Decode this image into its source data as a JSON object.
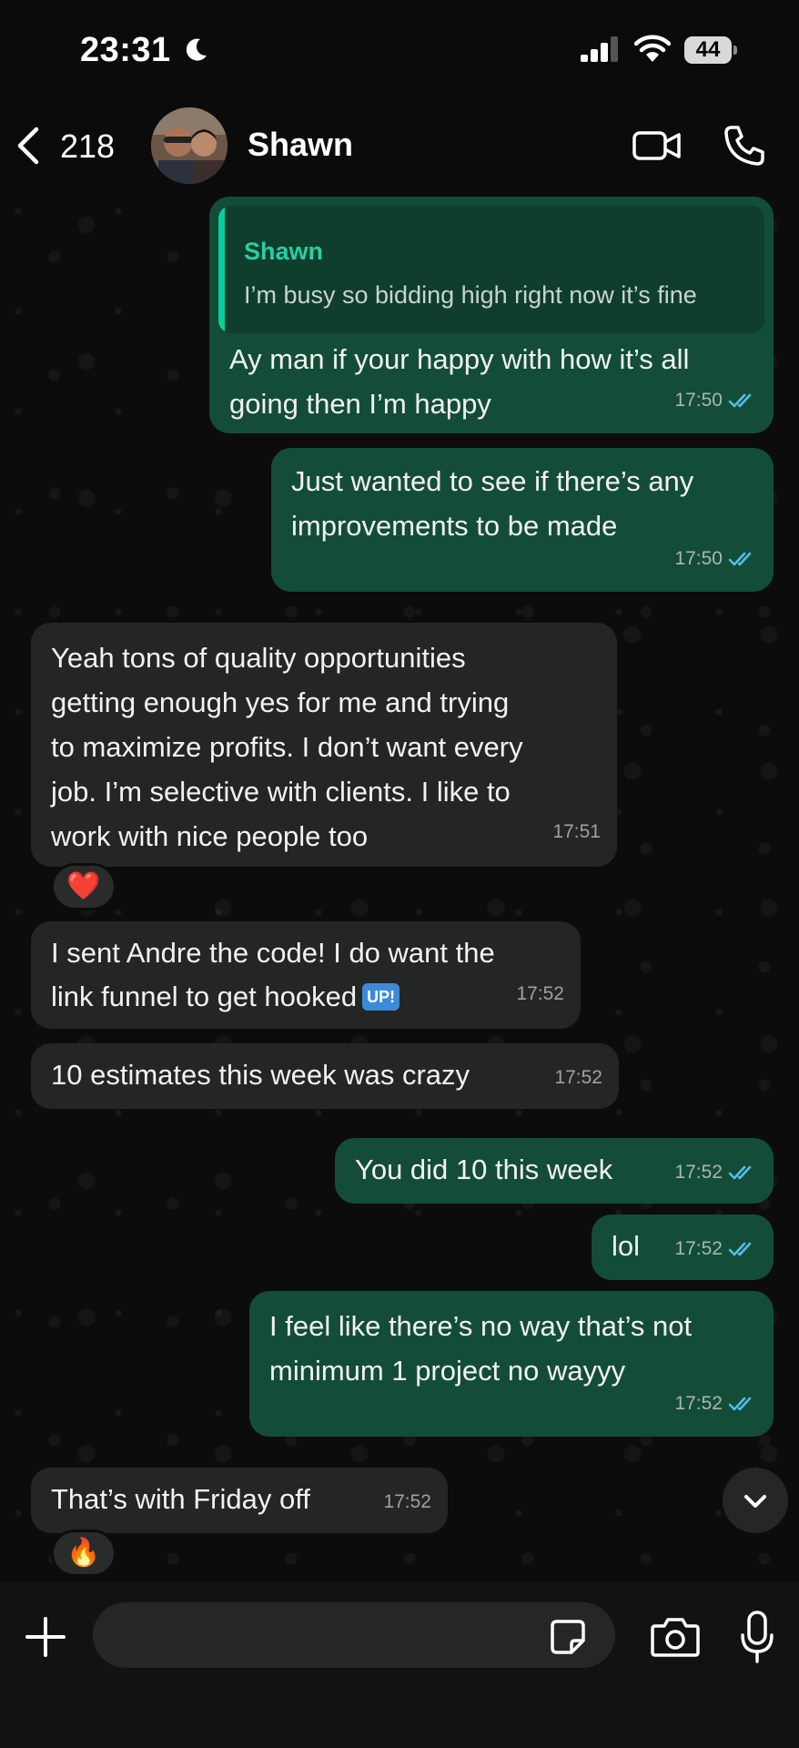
{
  "status_bar": {
    "time": "23:31",
    "battery": "44",
    "icons": [
      "moon-icon",
      "signal-icon",
      "wifi-icon",
      "battery-icon"
    ]
  },
  "header": {
    "back_count": "218",
    "contact_name": "Shawn",
    "icons": [
      "back-chevron-icon",
      "avatar",
      "video-call-icon",
      "phone-call-icon"
    ]
  },
  "messages": [
    {
      "direction": "outgoing",
      "quote_author": "Shawn",
      "quote_text": "I’m busy so bidding high right now it’s fine",
      "text": "Ay man if your happy with how it’s all\ngoing then I’m happy",
      "time": "17:50",
      "status": "read"
    },
    {
      "direction": "outgoing",
      "text": "Just wanted to see if there’s any\nimprovements to be made",
      "time": "17:50",
      "status": "read"
    },
    {
      "direction": "incoming",
      "text": "Yeah tons of quality opportunities\ngetting enough yes for me and trying\nto maximize profits. I don’t want every\njob. I’m selective with clients. I like to\nwork with nice people too",
      "time": "17:51",
      "reaction": "❤️"
    },
    {
      "direction": "incoming",
      "text_line1": "I sent Andre the code! I do want the",
      "text_line2": "link funnel to get hooked",
      "emoji_badge": "UP!",
      "time": "17:52"
    },
    {
      "direction": "incoming",
      "text": "10 estimates this week was crazy",
      "time": "17:52"
    },
    {
      "direction": "outgoing",
      "text": "You did 10 this week",
      "time": "17:52",
      "status": "read"
    },
    {
      "direction": "outgoing",
      "text": "lol",
      "time": "17:52",
      "status": "read"
    },
    {
      "direction": "outgoing",
      "text": "I feel like there’s no way that’s not\nminimum 1 project no wayyy",
      "time": "17:52",
      "status": "read"
    },
    {
      "direction": "incoming",
      "text": "That’s with Friday off",
      "time": "17:52",
      "reaction": "🔥"
    }
  ],
  "input_bar": {
    "placeholder": "",
    "icons": [
      "plus-icon",
      "sticker-icon",
      "camera-icon",
      "microphone-icon"
    ]
  },
  "colors": {
    "outgoing_bubble": "#134d37",
    "incoming_bubble": "#242626",
    "accent": "#25d0a3",
    "read_ticks": "#53bdeb"
  }
}
